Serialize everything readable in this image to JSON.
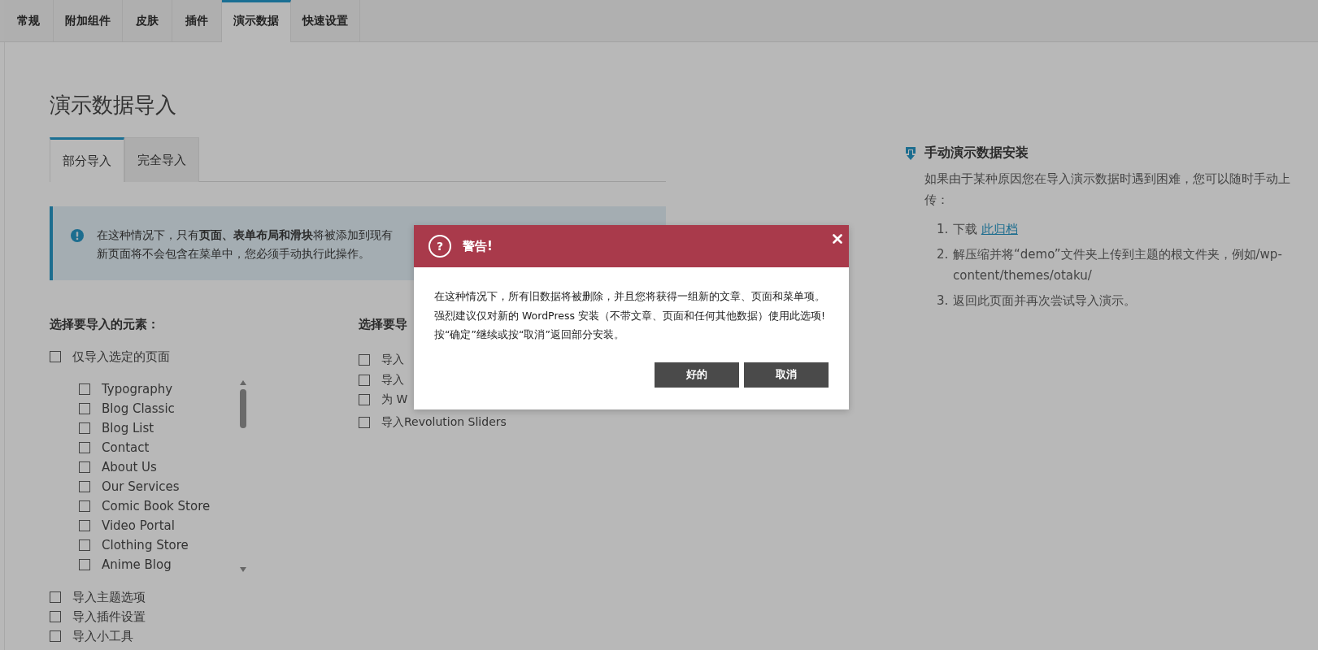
{
  "tabs": [
    {
      "label": "常规",
      "selected": false
    },
    {
      "label": "附加组件",
      "selected": false
    },
    {
      "label": "皮肤",
      "selected": false
    },
    {
      "label": "插件",
      "selected": false
    },
    {
      "label": "演示数据",
      "selected": true
    },
    {
      "label": "快速设置",
      "selected": false
    }
  ],
  "title": "演示数据导入",
  "import_tabs": [
    {
      "label": "部分导入",
      "selected": true
    },
    {
      "label": "完全导入",
      "selected": false
    }
  ],
  "notice": {
    "lines": [
      "在这种情况下，只有**页面、表单布局和滑块**将被添加到现有",
      "新页面将不会包含在菜单中，您必须手动执行此操作。"
    ]
  },
  "elements": {
    "heading": "选择要导入的元素：",
    "only_selected": {
      "label": "仅导入选定的页面",
      "checked": false
    },
    "pages": [
      {
        "label": "Typography",
        "checked": false
      },
      {
        "label": "Blog Classic",
        "checked": false
      },
      {
        "label": "Blog List",
        "checked": false
      },
      {
        "label": "Contact",
        "checked": false
      },
      {
        "label": "About Us",
        "checked": false
      },
      {
        "label": "Our Services",
        "checked": false
      },
      {
        "label": "Comic Book Store",
        "checked": false
      },
      {
        "label": "Video Portal",
        "checked": false
      },
      {
        "label": "Clothing Store",
        "checked": false
      },
      {
        "label": "Anime Blog",
        "checked": false
      }
    ],
    "options": [
      {
        "label": "导入主题选项",
        "checked": false
      },
      {
        "label": "导入插件设置",
        "checked": false
      },
      {
        "label": "导入小工具",
        "checked": false
      }
    ]
  },
  "second_column": {
    "heading": "选择要导",
    "options": [
      {
        "label": "导入",
        "checked": false
      },
      {
        "label": "导入",
        "checked": false
      },
      {
        "label": "为 W",
        "checked": false
      },
      {
        "label": "导入Revolution Sliders",
        "checked": false
      }
    ]
  },
  "manual": {
    "heading": "手动演示数据安装",
    "intro": "如果由于某种原因您在导入演示数据时遇到困难，您可以随时手动上传：",
    "steps": [
      {
        "number": "1.",
        "text": "下载",
        "link": "此归档"
      },
      {
        "number": "2.",
        "text": "解压缩并将“demo”文件夹上传到主题的根文件夹，例如/wp-content/themes/otaku/"
      },
      {
        "number": "3.",
        "text": "返回此页面并再次尝试导入演示。"
      }
    ]
  },
  "dialog": {
    "icon": "?",
    "title": "警告!",
    "lines": [
      "在这种情况下，所有旧数据将被删除，并且您将获得一组新的文章、页面和菜单项。",
      "强烈建议仅对新的 WordPress 安装（不带文章、页面和任何其他数据）使用此选项!",
      "按“确定”继续或按“取消”返回部分安装。"
    ],
    "buttons": [
      {
        "label": "好的"
      },
      {
        "label": "取消"
      }
    ]
  }
}
